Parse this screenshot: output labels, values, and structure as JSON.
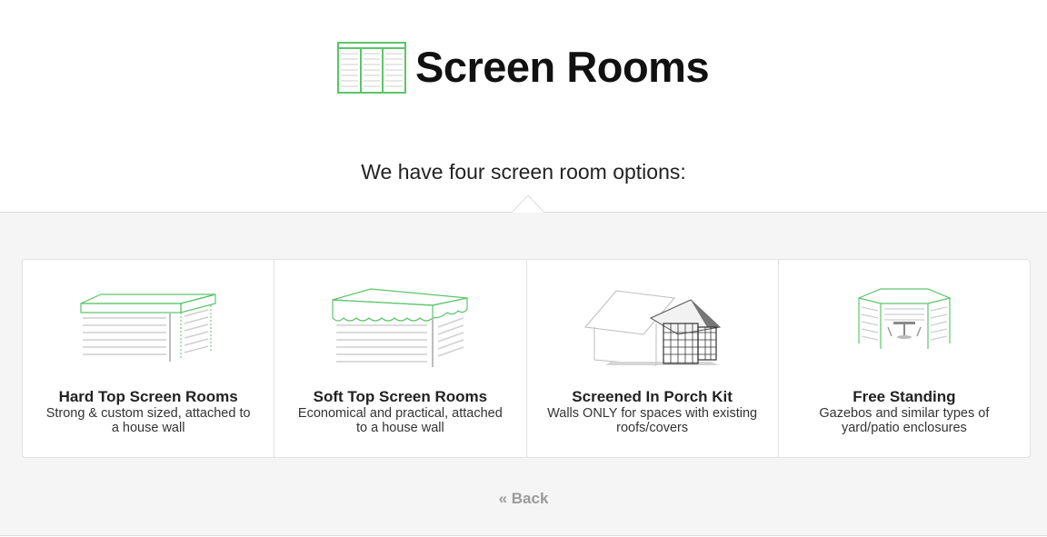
{
  "header": {
    "title": "Screen Rooms",
    "subtitle": "We have four screen room options:"
  },
  "options": [
    {
      "title": "Hard Top Screen Rooms",
      "description": "Strong & custom sized, attached to a house wall",
      "icon": "hard-top-screen-room-icon"
    },
    {
      "title": "Soft Top Screen Rooms",
      "description": "Economical and practical, attached to a house wall",
      "icon": "soft-top-screen-room-icon"
    },
    {
      "title": "Screened In Porch Kit",
      "description": "Walls ONLY for spaces with existing roofs/covers",
      "icon": "porch-kit-icon"
    },
    {
      "title": "Free Standing",
      "description": "Gazebos and similar types of yard/patio enclosures",
      "icon": "gazebo-icon"
    }
  ],
  "footer": {
    "back_label": "« Back"
  },
  "colors": {
    "accent_green": "#5cc46a",
    "line_gray": "#c8c8c8",
    "panel_bg": "#f5f5f5"
  }
}
